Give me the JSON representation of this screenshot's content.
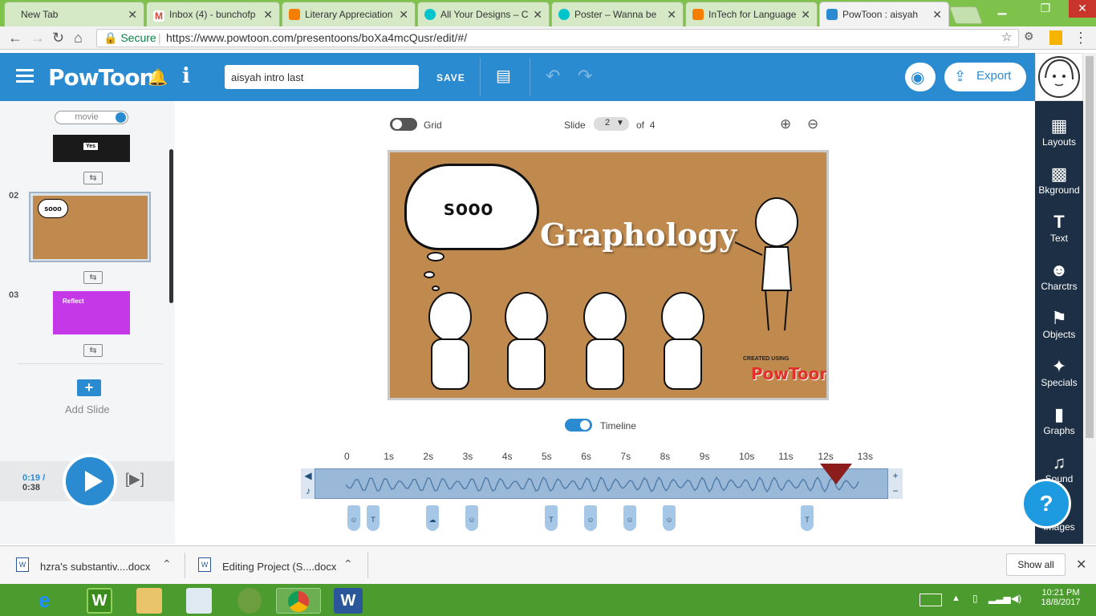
{
  "browser": {
    "tabs": [
      {
        "title": "New Tab",
        "color": "#cccccc"
      },
      {
        "title": "Inbox (4) - bunchofp",
        "color": "#d44638"
      },
      {
        "title": "Literary Appreciation",
        "color": "#f57d00"
      },
      {
        "title": "All Your Designs – C",
        "color": "#00c4cc"
      },
      {
        "title": "Poster – Wanna be ",
        "color": "#00c4cc"
      },
      {
        "title": "InTech for Language",
        "color": "#f57d00"
      },
      {
        "title": "PowToon : aisyah",
        "color": "#2a8bd1"
      }
    ],
    "secure_label": "Secure",
    "url": "https://www.powtoon.com/presentoons/boXa4mcQusr/edit/#/"
  },
  "app": {
    "logo": "PowToon",
    "title_value": "aisyah intro last",
    "save_label": "SAVE",
    "export_label": "Export",
    "brand_color": "#2a8bd1"
  },
  "right_toolbar": [
    {
      "label": "Layouts",
      "icon": "layouts-icon"
    },
    {
      "label": "Bkground",
      "icon": "background-icon"
    },
    {
      "label": "Text",
      "icon": "text-icon"
    },
    {
      "label": "Charctrs",
      "icon": "characters-icon"
    },
    {
      "label": "Objects",
      "icon": "objects-icon"
    },
    {
      "label": "Specials",
      "icon": "specials-icon"
    },
    {
      "label": "Graphs",
      "icon": "graphs-icon"
    },
    {
      "label": "Sound",
      "icon": "sound-icon"
    },
    {
      "label": "Images",
      "icon": "images-icon"
    }
  ],
  "left_panel": {
    "mode_toggle": "movie",
    "slides": [
      {
        "number": "",
        "content": "Yes"
      },
      {
        "number": "02",
        "content": "sooo"
      },
      {
        "number": "03",
        "content": "Reflect"
      }
    ],
    "add_slide_label": "Add Slide"
  },
  "player": {
    "current_time": "0:19 /",
    "total_time": "0:38"
  },
  "stage_controls": {
    "grid_label": "Grid",
    "slide_label": "Slide",
    "slide_current": "2",
    "slide_of": "of",
    "slide_total": "4"
  },
  "stage": {
    "bubble_text": "sooo",
    "title_text": "Graphology",
    "created_using": "CREATED USING",
    "created_logo": "PowToon"
  },
  "timeline": {
    "label": "Timeline",
    "ticks": [
      "0",
      "1s",
      "2s",
      "3s",
      "4s",
      "5s",
      "6s",
      "7s",
      "8s",
      "9s",
      "10s",
      "11s",
      "12s",
      "13s"
    ],
    "playhead_seconds": 12.4,
    "markers": [
      "char",
      "T",
      "bubble",
      "char",
      "T",
      "char",
      "char",
      "char",
      "T"
    ]
  },
  "downloads": [
    {
      "name": "hzra's substantiv....docx"
    },
    {
      "name": "Editing Project (S....docx"
    }
  ],
  "downloads_show_all": "Show all",
  "system": {
    "time": "10:21 PM",
    "date": "18/8/2017"
  }
}
